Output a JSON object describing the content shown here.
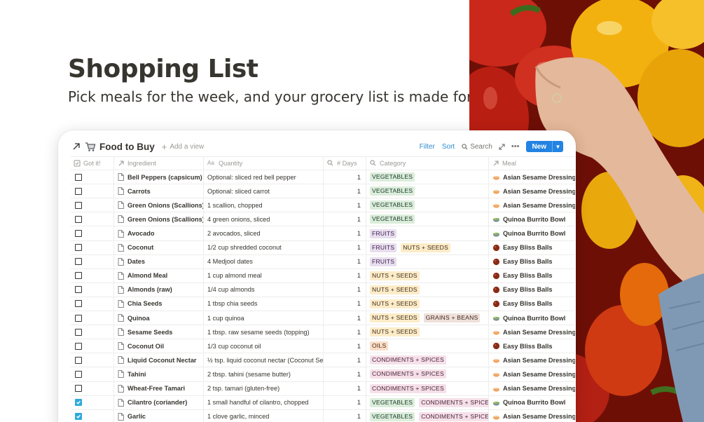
{
  "hero": {
    "title": "Shopping List",
    "subtitle": "Pick meals for the week, and your grocery list is made for you"
  },
  "toolbar": {
    "db_title": "Food to Buy",
    "add_view": "Add a view",
    "filter": "Filter",
    "sort": "Sort",
    "search": "Search",
    "new": "New"
  },
  "columns": {
    "got": "Got it!",
    "ingredient": "Ingredient",
    "quantity": "Quantity",
    "days": "# Days",
    "category": "Category",
    "meal": "Meal"
  },
  "tag_colors": {
    "VEGETABLES": {
      "bg": "#dbeddb",
      "fg": "#1c3829"
    },
    "FRUITS": {
      "bg": "#e8deee",
      "fg": "#412454"
    },
    "NUTS + SEEDS": {
      "bg": "#fdecc8",
      "fg": "#402c1b"
    },
    "GRAINS + BEANS": {
      "bg": "#eee0da",
      "fg": "#442a1e"
    },
    "OILS": {
      "bg": "#fadec9",
      "fg": "#49290e"
    },
    "CONDIMENTS + SPICES": {
      "bg": "#f5e0e9",
      "fg": "#4c2337"
    }
  },
  "meal_icons": {
    "Asian Sesame Dressing": "bowl-icon",
    "Quinoa Burrito Bowl": "burrito-bowl-icon",
    "Easy Bliss Balls": "bliss-ball-icon"
  },
  "rows": [
    {
      "checked": false,
      "ingredient": "Bell Peppers (capsicum)",
      "quantity": "Optional: sliced red bell pepper",
      "days": "1",
      "categories": [
        "VEGETABLES"
      ],
      "meal": "Asian Sesame Dressing"
    },
    {
      "checked": false,
      "ingredient": "Carrots",
      "quantity": "Optional: sliced carrot",
      "days": "1",
      "categories": [
        "VEGETABLES"
      ],
      "meal": "Asian Sesame Dressing"
    },
    {
      "checked": false,
      "ingredient": "Green Onions (Scallions)",
      "quantity": "1 scallion, chopped",
      "days": "1",
      "categories": [
        "VEGETABLES"
      ],
      "meal": "Asian Sesame Dressing"
    },
    {
      "checked": false,
      "ingredient": "Green Onions (Scallions)",
      "quantity": "4 green onions, sliced",
      "days": "1",
      "categories": [
        "VEGETABLES"
      ],
      "meal": "Quinoa Burrito Bowl"
    },
    {
      "checked": false,
      "ingredient": "Avocado",
      "quantity": "2 avocados, sliced",
      "days": "1",
      "categories": [
        "FRUITS"
      ],
      "meal": "Quinoa Burrito Bowl"
    },
    {
      "checked": false,
      "ingredient": "Coconut",
      "quantity": "1/2 cup shredded coconut",
      "days": "1",
      "categories": [
        "FRUITS",
        "NUTS + SEEDS"
      ],
      "meal": "Easy Bliss Balls"
    },
    {
      "checked": false,
      "ingredient": "Dates",
      "quantity": "4 Medjool dates",
      "days": "1",
      "categories": [
        "FRUITS"
      ],
      "meal": "Easy Bliss Balls"
    },
    {
      "checked": false,
      "ingredient": "Almond Meal",
      "quantity": "1 cup almond meal",
      "days": "1",
      "categories": [
        "NUTS + SEEDS"
      ],
      "meal": "Easy Bliss Balls"
    },
    {
      "checked": false,
      "ingredient": "Almonds (raw)",
      "quantity": "1/4 cup almonds",
      "days": "1",
      "categories": [
        "NUTS + SEEDS"
      ],
      "meal": "Easy Bliss Balls"
    },
    {
      "checked": false,
      "ingredient": "Chia Seeds",
      "quantity": "1 tbsp chia seeds",
      "days": "1",
      "categories": [
        "NUTS + SEEDS"
      ],
      "meal": "Easy Bliss Balls"
    },
    {
      "checked": false,
      "ingredient": "Quinoa",
      "quantity": "1 cup quinoa",
      "days": "1",
      "categories": [
        "NUTS + SEEDS",
        "GRAINS + BEANS"
      ],
      "meal": "Quinoa Burrito Bowl"
    },
    {
      "checked": false,
      "ingredient": "Sesame Seeds",
      "quantity": "1 tbsp. raw sesame seeds (topping)",
      "days": "1",
      "categories": [
        "NUTS + SEEDS"
      ],
      "meal": "Asian Sesame Dressing"
    },
    {
      "checked": false,
      "ingredient": "Coconut Oil",
      "quantity": "1/3 cup coconut oil",
      "days": "1",
      "categories": [
        "OILS"
      ],
      "meal": "Easy Bliss Balls"
    },
    {
      "checked": false,
      "ingredient": "Liquid Coconut Nectar",
      "quantity": "½ tsp. liquid coconut nectar (Coconut Se",
      "days": "1",
      "categories": [
        "CONDIMENTS + SPICES"
      ],
      "meal": "Asian Sesame Dressing"
    },
    {
      "checked": false,
      "ingredient": "Tahini",
      "quantity": "2 tbsp. tahini (sesame butter)",
      "days": "1",
      "categories": [
        "CONDIMENTS + SPICES"
      ],
      "meal": "Asian Sesame Dressing"
    },
    {
      "checked": false,
      "ingredient": "Wheat-Free Tamari",
      "quantity": "2 tsp. tamari (gluten-free)",
      "days": "1",
      "categories": [
        "CONDIMENTS + SPICES"
      ],
      "meal": "Asian Sesame Dressing"
    },
    {
      "checked": true,
      "ingredient": "Cilantro (coriander)",
      "quantity": "1 small handful of cilantro, chopped",
      "days": "1",
      "categories": [
        "VEGETABLES",
        "CONDIMENTS + SPICES"
      ],
      "meal": "Quinoa Burrito Bowl"
    },
    {
      "checked": true,
      "ingredient": "Garlic",
      "quantity": "1 clove garlic, minced",
      "days": "1",
      "categories": [
        "VEGETABLES",
        "CONDIMENTS + SPICES"
      ],
      "meal": "Asian Sesame Dressing"
    }
  ]
}
